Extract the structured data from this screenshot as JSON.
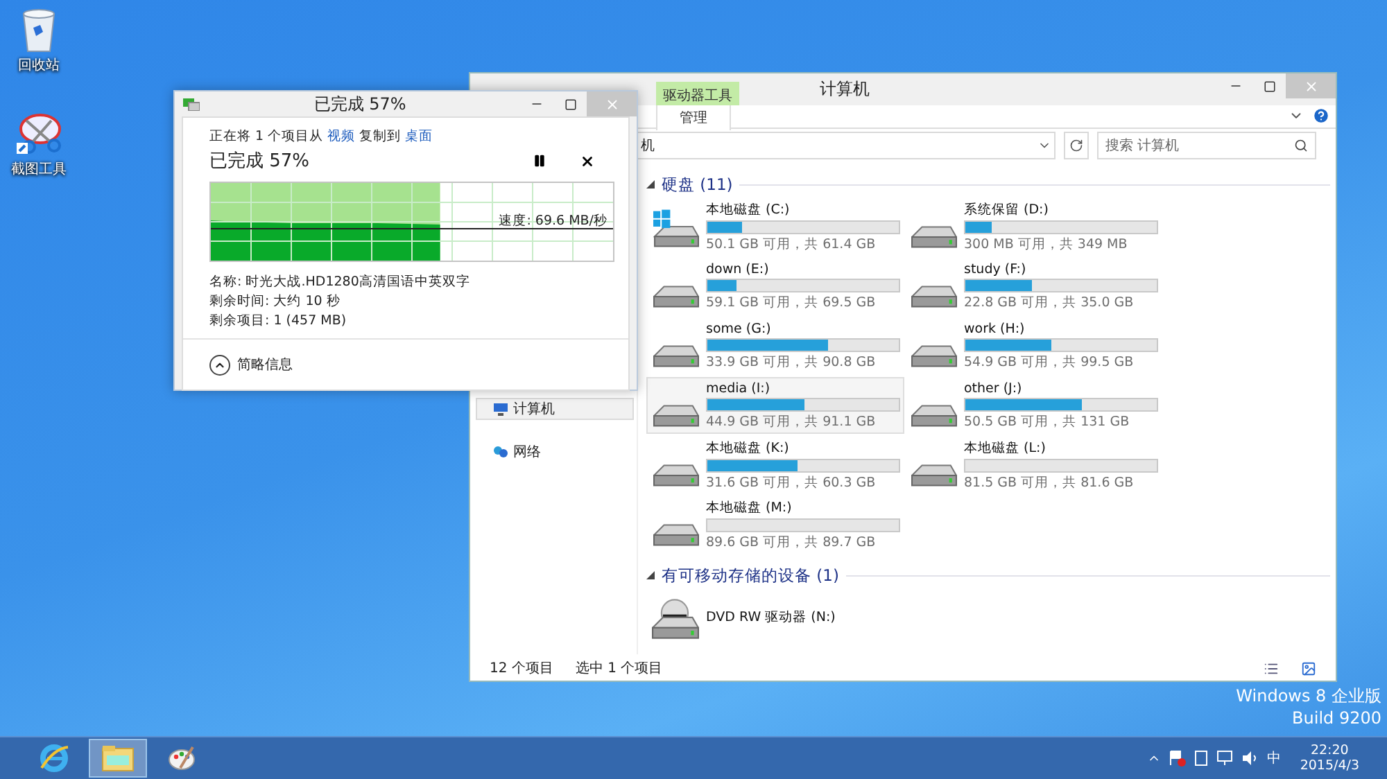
{
  "desktop_icons": [
    {
      "label": "回收站",
      "kind": "recycle"
    },
    {
      "label": "截图工具",
      "kind": "snip"
    }
  ],
  "os_watermark": [
    "Windows 8 企业版",
    "Build 9200"
  ],
  "explorer": {
    "title": "计算机",
    "contextual_tab": "驱动器工具",
    "ribbon_tab": "管理",
    "address": "机",
    "search_placeholder": "搜索 计算机",
    "nav": [
      {
        "label": "计算机",
        "selected": true,
        "kind": "computer"
      },
      {
        "label": "网络",
        "selected": false,
        "kind": "network"
      }
    ],
    "groups": [
      {
        "title": "硬盘 (11)",
        "expanded": true,
        "items": [
          {
            "name": "本地磁盘 (C:)",
            "info": "50.1 GB 可用，共 61.4 GB",
            "level": 0.18,
            "selected": false,
            "kind": "system"
          },
          {
            "name": "系统保留 (D:)",
            "info": "300 MB 可用，共 349 MB",
            "level": 0.14,
            "selected": false,
            "kind": "disk"
          },
          {
            "name": "down (E:)",
            "info": "59.1 GB 可用，共 69.5 GB",
            "level": 0.15,
            "selected": false,
            "kind": "disk"
          },
          {
            "name": "study (F:)",
            "info": "22.8 GB 可用，共 35.0 GB",
            "level": 0.35,
            "selected": false,
            "kind": "disk"
          },
          {
            "name": "some (G:)",
            "info": "33.9 GB 可用，共 90.8 GB",
            "level": 0.63,
            "selected": false,
            "kind": "disk"
          },
          {
            "name": "work (H:)",
            "info": "54.9 GB 可用，共 99.5 GB",
            "level": 0.45,
            "selected": false,
            "kind": "disk"
          },
          {
            "name": "media (I:)",
            "info": "44.9 GB 可用，共 91.1 GB",
            "level": 0.51,
            "selected": true,
            "kind": "disk"
          },
          {
            "name": "other (J:)",
            "info": "50.5 GB 可用，共 131 GB",
            "level": 0.61,
            "selected": false,
            "kind": "disk"
          },
          {
            "name": "本地磁盘 (K:)",
            "info": "31.6 GB 可用，共 60.3 GB",
            "level": 0.47,
            "selected": false,
            "kind": "disk"
          },
          {
            "name": "本地磁盘 (L:)",
            "info": "81.5 GB 可用，共 81.6 GB",
            "level": 0.0,
            "selected": false,
            "kind": "disk"
          },
          {
            "name": "本地磁盘 (M:)",
            "info": "89.6 GB 可用，共 89.7 GB",
            "level": 0.0,
            "selected": false,
            "kind": "disk"
          }
        ]
      },
      {
        "title": "有可移动存储的设备 (1)",
        "expanded": true,
        "items": [
          {
            "name": "DVD RW 驱动器 (N:)",
            "selected": false,
            "kind": "dvd"
          }
        ]
      }
    ],
    "status": [
      "12 个项目",
      "选中 1 个项目"
    ]
  },
  "copy_dialog": {
    "title": "已完成 57%",
    "description": [
      {
        "text": "正在将 1 个项目从 ",
        "kind": "text"
      },
      {
        "text": "视频",
        "kind": "link"
      },
      {
        "text": " 复制到 ",
        "kind": "text"
      },
      {
        "text": "桌面",
        "kind": "link"
      }
    ],
    "heading": "已完成 57%",
    "progress": {
      "level": 0.57,
      "speed": "速度: 69.6 MB/秒"
    },
    "details": [
      "名称: 时光大战.HD1280高清国语中英双字",
      "剩余时间: 大约 10 秒",
      "剩余项目: 1 (457 MB)"
    ],
    "toggle": "简略信息"
  },
  "taskbar": {
    "apps": [
      {
        "kind": "ie",
        "active": false
      },
      {
        "kind": "explorer",
        "active": true
      },
      {
        "kind": "paint",
        "active": false
      }
    ],
    "ime": "中",
    "time": "22:20",
    "date": "2015/4/3"
  }
}
